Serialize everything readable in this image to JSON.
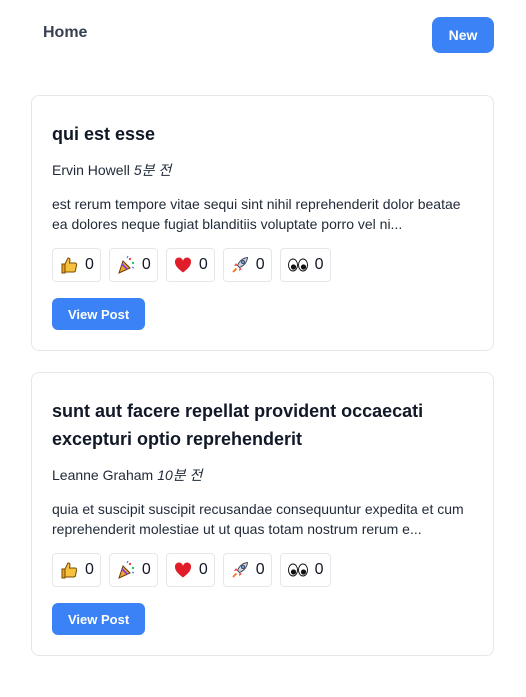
{
  "header": {
    "home_label": "Home",
    "new_label": "New"
  },
  "colors": {
    "accent": "#3b82f6",
    "border": "#e5e7eb"
  },
  "posts": [
    {
      "title": "qui est esse",
      "author": "Ervin Howell",
      "time": "5분 전",
      "body": "est rerum tempore vitae sequi sint nihil reprehenderit dolor beatae ea dolores neque fugiat blanditiis voluptate porro vel ni...",
      "reactions": [
        {
          "icon": "thumbs-up-icon",
          "count": "0"
        },
        {
          "icon": "party-popper-icon",
          "count": "0"
        },
        {
          "icon": "heart-icon",
          "count": "0"
        },
        {
          "icon": "rocket-icon",
          "count": "0"
        },
        {
          "icon": "eyes-icon",
          "count": "0"
        }
      ],
      "view_label": "View Post"
    },
    {
      "title": "sunt aut facere repellat provident occaecati excepturi optio reprehenderit",
      "author": "Leanne Graham",
      "time": "10분 전",
      "body": "quia et suscipit suscipit recusandae consequuntur expedita et cum reprehenderit molestiae ut ut quas totam nostrum rerum e...",
      "reactions": [
        {
          "icon": "thumbs-up-icon",
          "count": "0"
        },
        {
          "icon": "party-popper-icon",
          "count": "0"
        },
        {
          "icon": "heart-icon",
          "count": "0"
        },
        {
          "icon": "rocket-icon",
          "count": "0"
        },
        {
          "icon": "eyes-icon",
          "count": "0"
        }
      ],
      "view_label": "View Post"
    }
  ]
}
